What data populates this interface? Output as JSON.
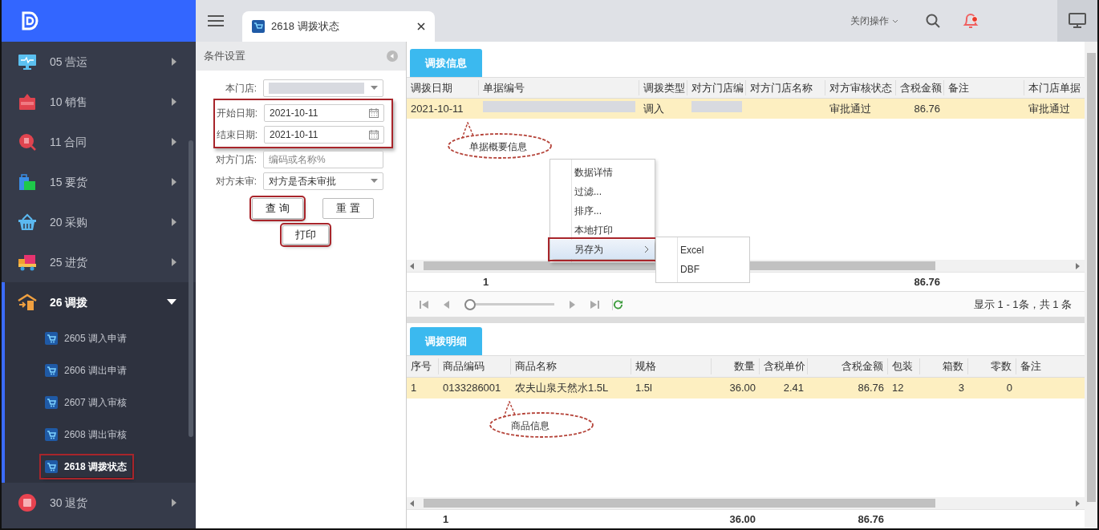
{
  "sidebar": {
    "menu": [
      {
        "label": "05 营运",
        "kind": "monitor",
        "expanded": false
      },
      {
        "label": "10 销售",
        "kind": "sale",
        "expanded": false
      },
      {
        "label": "11 合同",
        "kind": "contract",
        "expanded": false
      },
      {
        "label": "15 要货",
        "kind": "bag",
        "expanded": false
      },
      {
        "label": "20 采购",
        "kind": "basket",
        "expanded": false
      },
      {
        "label": "25 进货",
        "kind": "truck",
        "expanded": false
      },
      {
        "label": "26 调拨",
        "kind": "transfer",
        "expanded": true,
        "children": [
          {
            "label": "2605 调入申请",
            "selected": false,
            "highlighted": false
          },
          {
            "label": "2606 调出申请",
            "selected": false,
            "highlighted": false
          },
          {
            "label": "2607 调入审核",
            "selected": false,
            "highlighted": false
          },
          {
            "label": "2608 调出审核",
            "selected": false,
            "highlighted": false
          },
          {
            "label": "2618 调拨状态",
            "selected": true,
            "highlighted": true
          }
        ]
      },
      {
        "label": "30 退货",
        "kind": "return",
        "expanded": false
      }
    ]
  },
  "topbar": {
    "tabs": [
      {
        "label": "2618 调拨状态",
        "selected": true
      }
    ],
    "close_menu": "关闭操作",
    "notification": true
  },
  "filter_panel": {
    "title": "条件设置",
    "fields": [
      {
        "label": "本门店:",
        "kind": "select",
        "redacted": true,
        "highlighted": false
      },
      {
        "label": "开始日期:",
        "kind": "date",
        "value": "2021-10-11",
        "highlighted": true
      },
      {
        "label": "结束日期:",
        "kind": "date",
        "value": "2021-10-11",
        "highlighted": true
      },
      {
        "label": "对方门店:",
        "kind": "text",
        "placeholder": "编码或名称%",
        "highlighted": false
      },
      {
        "label": "对方未审:",
        "kind": "select",
        "value": "对方是否未审批",
        "highlighted": false
      }
    ],
    "buttons": [
      {
        "label": "查 询",
        "highlighted": true
      },
      {
        "label": "重 置",
        "highlighted": false
      }
    ],
    "print_button": {
      "label": "打印",
      "highlighted": true
    }
  },
  "transfer_grid": {
    "tab": "调拨信息",
    "columns": [
      "调拨日期",
      "单据编号",
      "调拨类型",
      "对方门店编",
      "对方门店名称",
      "对方审核状态",
      "含税金额",
      "备注",
      "本门店单据"
    ],
    "rows": [
      {
        "selected": true,
        "cells": [
          "2021-10-11",
          {
            "kind": "redacted"
          },
          "调入",
          {
            "kind": "redacted"
          },
          {
            "kind": "blank"
          },
          "审批通过",
          "86.76",
          {
            "kind": "blank"
          },
          "审批通过"
        ]
      }
    ],
    "footer": [
      {
        "kind": "blank"
      },
      "1",
      {
        "kind": "blank"
      },
      {
        "kind": "blank"
      },
      {
        "kind": "blank"
      },
      {
        "kind": "blank"
      },
      "86.76"
    ],
    "callout": "单据概要信息",
    "pager": {
      "level": 0,
      "summary": "显示 1 - 1条，共 1 条"
    }
  },
  "context_menu": {
    "items": [
      {
        "label": "数据详情",
        "selected": false
      },
      {
        "label": "过滤...",
        "selected": false
      },
      {
        "label": "排序...",
        "selected": false
      },
      {
        "label": "本地打印",
        "selected": false
      },
      {
        "label": "另存为",
        "selected": true,
        "highlighted": true,
        "submenu": [
          {
            "label": "Excel",
            "selected": false
          },
          {
            "label": "DBF",
            "selected": false
          }
        ]
      }
    ]
  },
  "detail_grid": {
    "tab": "调拨明细",
    "columns": [
      "序号",
      "商品编码",
      "商品名称",
      "规格",
      "数量",
      "含税单价",
      "含税金额",
      "包装",
      "箱数",
      "零数",
      "备注"
    ],
    "rows": [
      {
        "selected": true,
        "cells": [
          "1",
          "0133286001",
          "农夫山泉天然水1.5L",
          "1.5l",
          "36.00",
          "2.41",
          "86.76",
          "12",
          "3",
          "0"
        ]
      }
    ],
    "footer": [
      {
        "kind": "blank"
      },
      "1",
      {
        "kind": "blank"
      },
      {
        "kind": "blank"
      },
      "36.00",
      {
        "kind": "blank"
      },
      "86.76"
    ],
    "callout": "商品信息"
  }
}
